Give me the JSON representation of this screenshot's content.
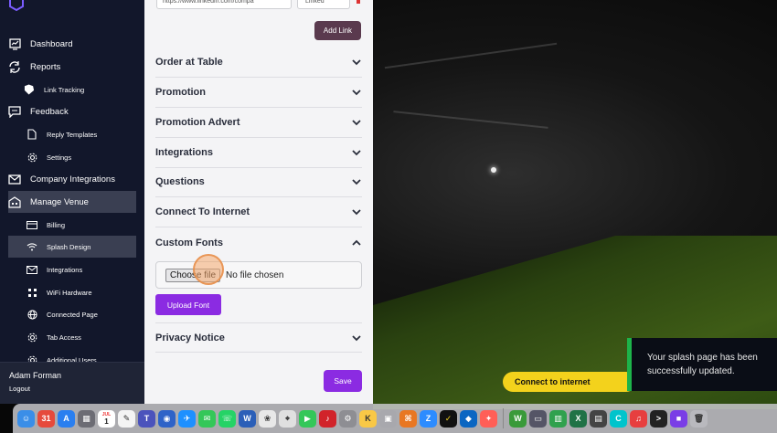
{
  "sidebar": {
    "items": [
      {
        "label": "Dashboard",
        "icon": "dashboard-icon"
      },
      {
        "label": "Reports",
        "icon": "refresh-icon"
      },
      {
        "label": "Link Tracking",
        "icon": "badge-icon"
      },
      {
        "label": "Feedback",
        "icon": "chat-icon"
      },
      {
        "label": "Reply Templates",
        "icon": "document-icon"
      },
      {
        "label": "Settings",
        "icon": "gear-icon"
      },
      {
        "label": "Company Integrations",
        "icon": "mail-icon"
      },
      {
        "label": "Manage Venue",
        "icon": "building-icon"
      },
      {
        "label": "Billing",
        "icon": "card-icon"
      },
      {
        "label": "Splash Design",
        "icon": "wifi-icon"
      },
      {
        "label": "Integrations",
        "icon": "mail-icon"
      },
      {
        "label": "WiFi Hardware",
        "icon": "grid-icon"
      },
      {
        "label": "Connected Page",
        "icon": "globe-icon"
      },
      {
        "label": "Tab Access",
        "icon": "gear-icon"
      },
      {
        "label": "Additional Users",
        "icon": "gear-icon"
      }
    ],
    "user_name": "Adam Forman",
    "logout_label": "Logout"
  },
  "panel": {
    "url_value": "https://www.linkedin.com/compa",
    "link_type_value": "Linked",
    "add_link_label": "Add Link",
    "sections": [
      "Order at Table",
      "Promotion",
      "Promotion Advert",
      "Integrations",
      "Questions",
      "Connect To Internet",
      "Custom Fonts",
      "Privacy Notice"
    ],
    "choose_file_label": "Choose file",
    "no_file_text": "No file chosen",
    "upload_font_label": "Upload Font",
    "save_label": "Save"
  },
  "preview": {
    "connect_label": "Connect to internet"
  },
  "toast": {
    "message": "Your splash page has been successfully updated."
  },
  "dock": {
    "calendar_month": "JUL",
    "calendar_day": "1"
  },
  "colors": {
    "sidebar_bg": "#12172b",
    "accent_purple": "#8b2be2",
    "add_link_bg": "#5a3a4e",
    "connect_yellow": "#f3d21c",
    "toast_green": "#1db34a"
  }
}
